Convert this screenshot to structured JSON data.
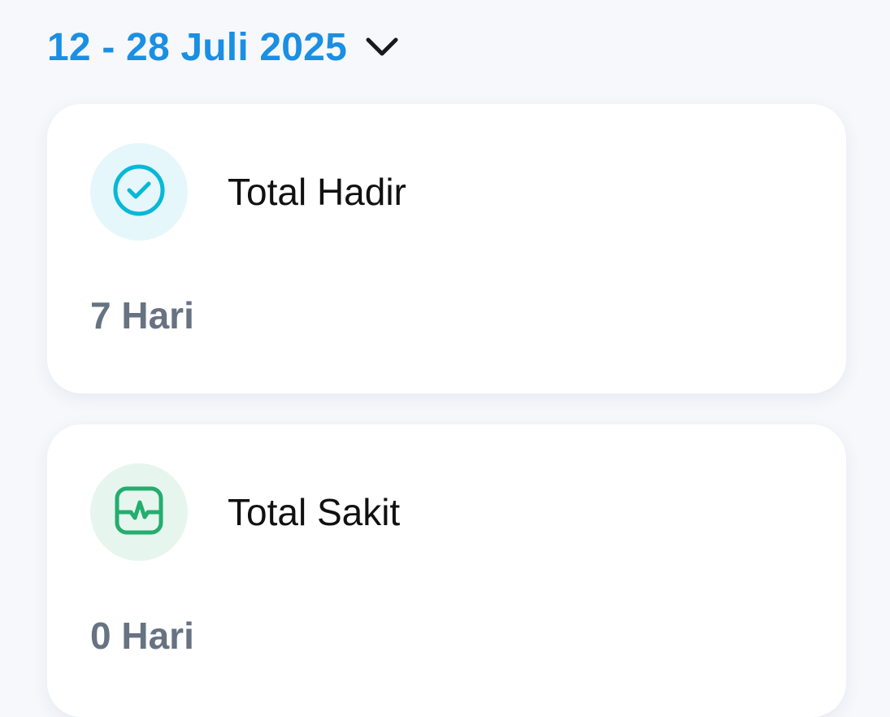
{
  "period": {
    "date_range": "12 - 28 Juli 2025",
    "dropdown_icon": "chevron-down-icon"
  },
  "cards": [
    {
      "title": "Total Hadir",
      "value": "7 Hari",
      "icon": "check-circle-icon",
      "icon_color": "#07b8d7",
      "icon_bg": "#e6f7fb"
    },
    {
      "title": "Total Sakit",
      "value": "0 Hari",
      "icon": "heart-rate-icon",
      "icon_color": "#24ad6f",
      "icon_bg": "#e6f6ee"
    }
  ],
  "colors": {
    "accent": "#1a8fe3",
    "background": "#f6f8fc",
    "value_text": "#677382",
    "title_text": "#111111"
  }
}
